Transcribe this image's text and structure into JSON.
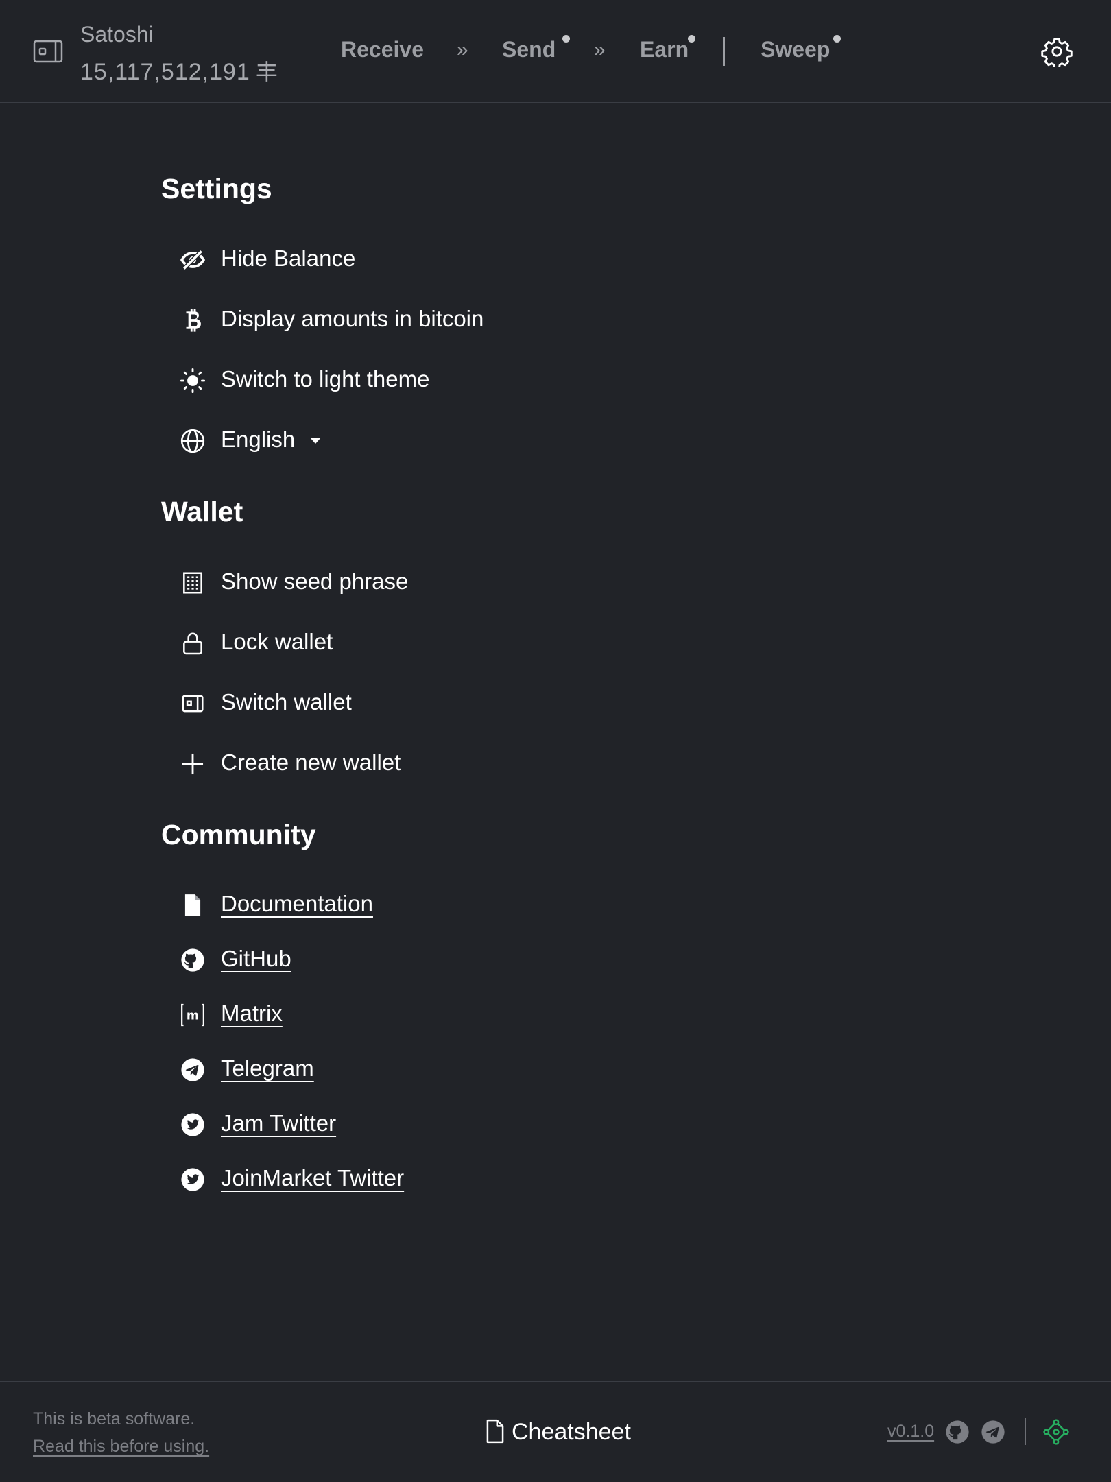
{
  "header": {
    "wallet_name": "Satoshi",
    "wallet_balance": "15,117,512,191",
    "balance_unit_symbol": "丰",
    "nav": {
      "receive": "Receive",
      "sep1": "»",
      "send": "Send",
      "sep2": "»",
      "earn": "Earn",
      "sweep": "Sweep"
    },
    "settings_icon": "gear-icon"
  },
  "settings": {
    "title": "Settings",
    "hide_balance": "Hide Balance",
    "display_bitcoin": "Display amounts in bitcoin",
    "light_theme": "Switch to light theme",
    "language": "English"
  },
  "wallet": {
    "title": "Wallet",
    "show_seed": "Show seed phrase",
    "lock": "Lock wallet",
    "switch": "Switch wallet",
    "create": "Create new wallet"
  },
  "community": {
    "title": "Community",
    "links": {
      "documentation": "Documentation",
      "github": "GitHub",
      "matrix": "Matrix",
      "telegram": "Telegram",
      "jam_twitter": "Jam Twitter",
      "joinmarket_twitter": "JoinMarket Twitter"
    }
  },
  "footer": {
    "beta_text": "This is beta software.",
    "beta_link": "Read this before using.",
    "cheatsheet": "Cheatsheet",
    "version": "v0.1.0",
    "status_color": "#27ae60"
  },
  "colors": {
    "background": "#212328",
    "text": "#ffffff",
    "muted": "#7c7e84",
    "nav": "#9c9ea3"
  }
}
